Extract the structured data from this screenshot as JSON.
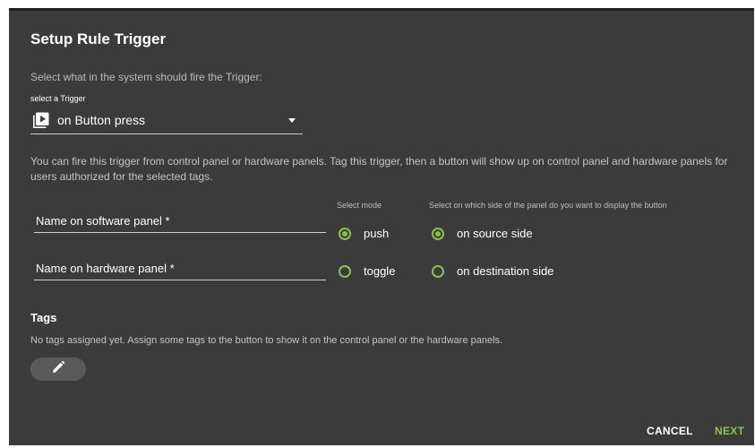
{
  "dialog": {
    "title": "Setup Rule Trigger",
    "intro": "Select what in the system should fire the Trigger:",
    "trigger_select": {
      "label": "select a Trigger",
      "value": "on Button press",
      "icon": "play-box-icon"
    },
    "description": "You can fire this trigger from control panel or hardware panels. Tag this trigger, then a button will show up on control panel and hardware panels for users authorized for the selected tags.",
    "fields": {
      "software_name": "Name on software panel *",
      "hardware_name": "Name on hardware panel *"
    },
    "mode": {
      "label": "Select mode",
      "options": [
        {
          "label": "push",
          "selected": true
        },
        {
          "label": "toggle",
          "selected": false
        }
      ]
    },
    "side": {
      "label": "Select on which side of the panel do you want to display the button",
      "options": [
        {
          "label": "on source side",
          "selected": true
        },
        {
          "label": "on destination side",
          "selected": false
        }
      ]
    },
    "tags": {
      "heading": "Tags",
      "message": "No tags assigned yet. Assign some tags to the button to show it on the control panel or the hardware panels.",
      "edit_icon": "pencil-icon"
    },
    "actions": {
      "cancel": "CANCEL",
      "next": "NEXT"
    },
    "colors": {
      "background": "#3b3b3b",
      "accent": "#8bc34a"
    }
  }
}
